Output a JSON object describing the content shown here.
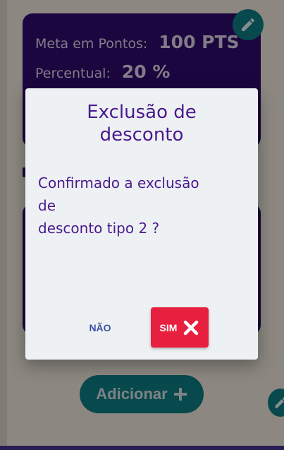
{
  "background": {
    "card_1": {
      "rows": [
        {
          "label": "Meta em Pontos:",
          "value": "100 PTS"
        },
        {
          "label": "Percentual:",
          "value": "20 %"
        }
      ]
    },
    "add_button": {
      "label": "Adicionar"
    }
  },
  "dialog": {
    "title_line_1": "Exclusão de",
    "title_line_2": "desconto",
    "message_line_1": "Confirmado a exclusão",
    "message_line_2": "de",
    "message_line_3": "desconto tipo 2 ?",
    "no_label": "NÃO",
    "yes_label": "SIM"
  },
  "colors": {
    "card": "#2a0a5e",
    "teal": "#0c6c73",
    "dialog_text": "#4a1a8c",
    "danger": "#e6203e"
  },
  "icons": {
    "edit": "pencil-icon",
    "add": "plus-icon",
    "close": "close-icon"
  }
}
